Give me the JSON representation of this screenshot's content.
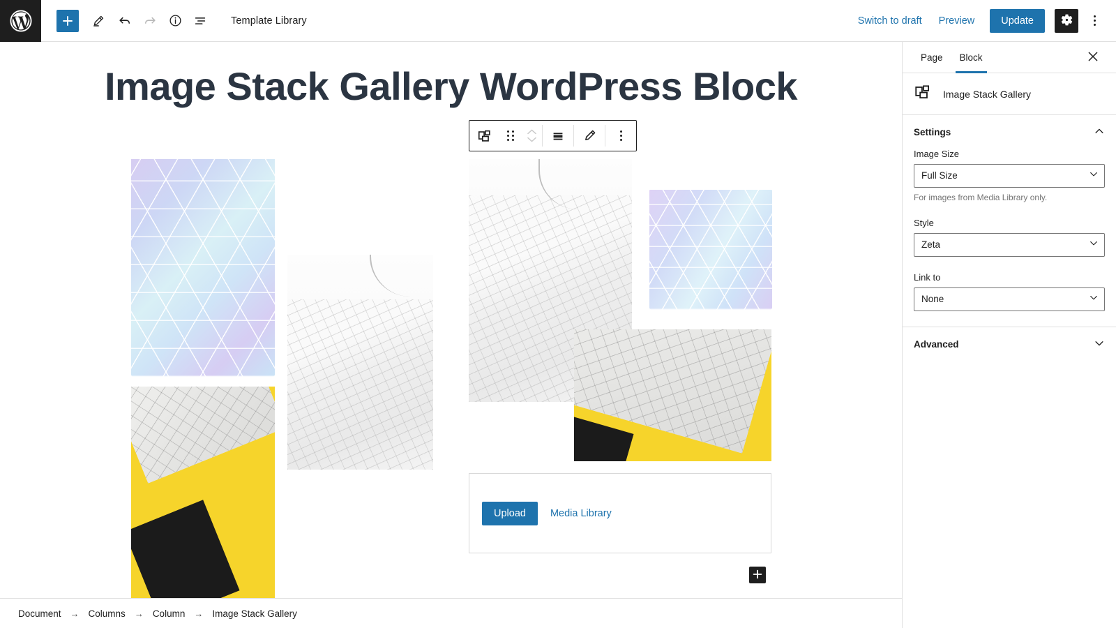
{
  "topbar": {
    "logo_icon": "wordpress-logo-icon",
    "add_block_label": "+",
    "tools": [
      {
        "name": "add-block-button",
        "icon": "plus-icon"
      },
      {
        "name": "edit-tool-button",
        "icon": "pencil-icon"
      },
      {
        "name": "undo-button",
        "icon": "undo-arrow-icon"
      },
      {
        "name": "redo-button",
        "icon": "redo-arrow-icon"
      },
      {
        "name": "details-button",
        "icon": "info-circle-icon"
      },
      {
        "name": "list-view-button",
        "icon": "list-view-icon"
      }
    ],
    "document_title": "Template Library",
    "switch_to_draft_label": "Switch to draft",
    "preview_label": "Preview",
    "update_label": "Update",
    "settings_icon": "gear-icon",
    "options_icon": "kebab-menu-icon"
  },
  "editor": {
    "post_title": "Image Stack Gallery WordPress Block",
    "block_toolbar": {
      "block_type_icon": "image-stack-gallery-icon",
      "drag_handle_icon": "drag-dots-icon",
      "move_icon": "move-up-down-icon",
      "align_icon": "align-wide-icon",
      "edit_icon": "pencil-icon",
      "more_icon": "kebab-menu-icon"
    },
    "placeholder": {
      "upload_label": "Upload",
      "media_library_label": "Media Library"
    },
    "add_block_bottom_icon": "plus-icon"
  },
  "breadcrumb": {
    "separator": "→",
    "items": [
      "Document",
      "Columns",
      "Column",
      "Image Stack Gallery"
    ]
  },
  "sidebar": {
    "tabs": [
      {
        "label": "Page",
        "active": false
      },
      {
        "label": "Block",
        "active": true
      }
    ],
    "close_icon": "close-icon",
    "block_card": {
      "icon": "image-stack-gallery-icon",
      "title": "Image Stack Gallery"
    },
    "settings": {
      "heading": "Settings",
      "collapse_icon": "chevron-up-icon",
      "fields": [
        {
          "label": "Image Size",
          "value": "Full Size",
          "help": "For images from Media Library only.",
          "name": "image-size-select"
        },
        {
          "label": "Style",
          "value": "Zeta",
          "help": "",
          "name": "style-select"
        },
        {
          "label": "Link to",
          "value": "None",
          "help": "",
          "name": "link-to-select"
        }
      ]
    },
    "advanced": {
      "heading": "Advanced",
      "expand_icon": "chevron-down-icon"
    }
  },
  "colors": {
    "accent_blue": "#1e73ad",
    "dark": "#1e1e1e",
    "title_text": "#2b3542",
    "border": "#e0e0e0",
    "yellow": "#f6d42b"
  }
}
